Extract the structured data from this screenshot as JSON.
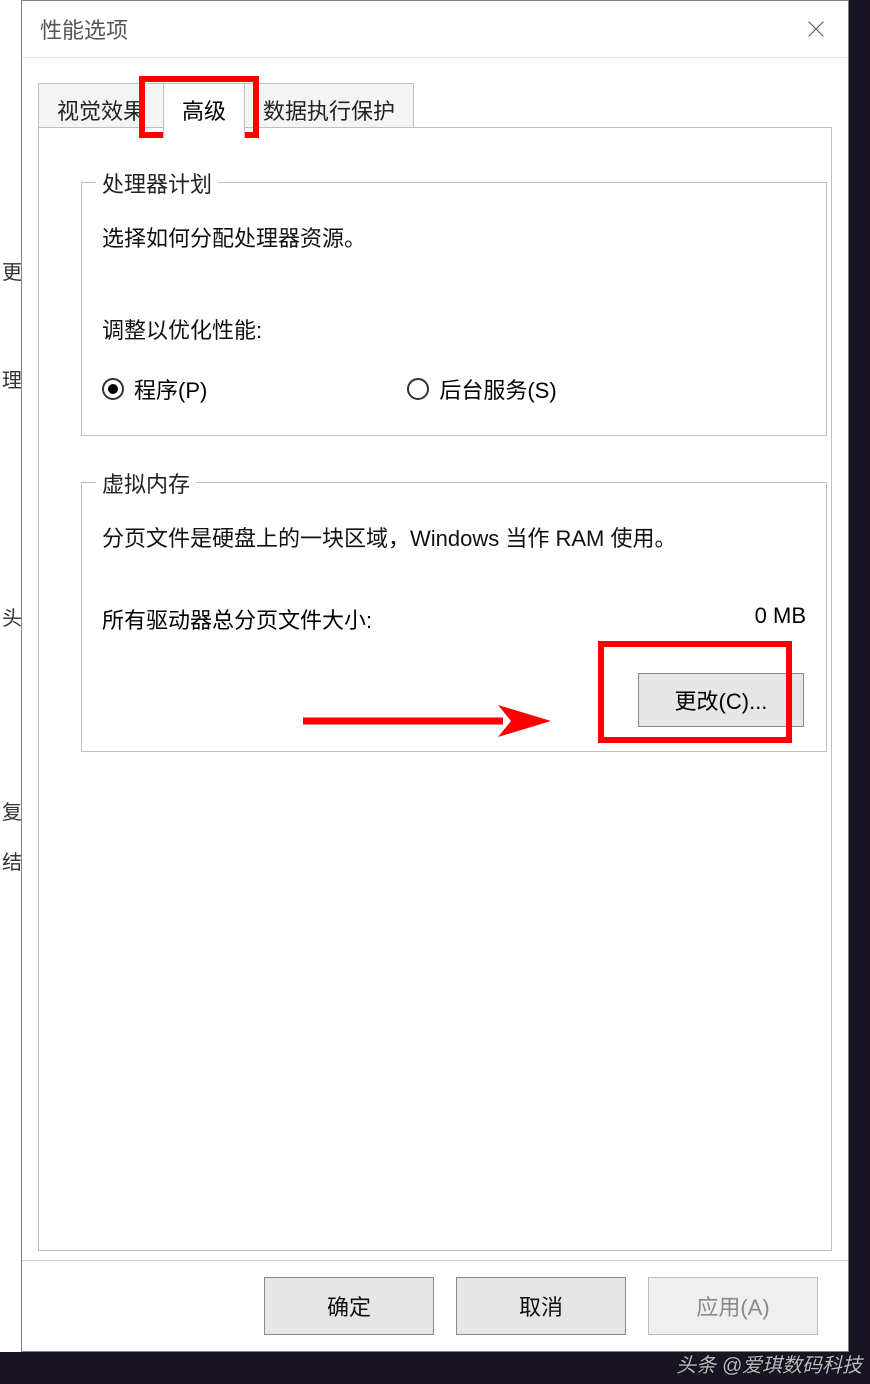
{
  "window": {
    "title": "性能选项"
  },
  "tabs": {
    "visual": "视觉效果",
    "advanced": "高级",
    "dep": "数据执行保护",
    "active_index": 1
  },
  "processor": {
    "legend": "处理器计划",
    "desc": "选择如何分配处理器资源。",
    "adjust_label": "调整以优化性能:",
    "radio_programs": "程序(P)",
    "radio_services": "后台服务(S)",
    "selected": "programs"
  },
  "vm": {
    "legend": "虚拟内存",
    "desc": "分页文件是硬盘上的一块区域，Windows 当作 RAM 使用。",
    "total_label": "所有驱动器总分页文件大小:",
    "total_value": "0 MB",
    "change_btn": "更改(C)..."
  },
  "buttons": {
    "ok": "确定",
    "cancel": "取消",
    "apply": "应用(A)"
  },
  "side_text": [
    "更",
    "理",
    "头",
    "复",
    "结"
  ],
  "watermark": "头条 @爱琪数码科技"
}
